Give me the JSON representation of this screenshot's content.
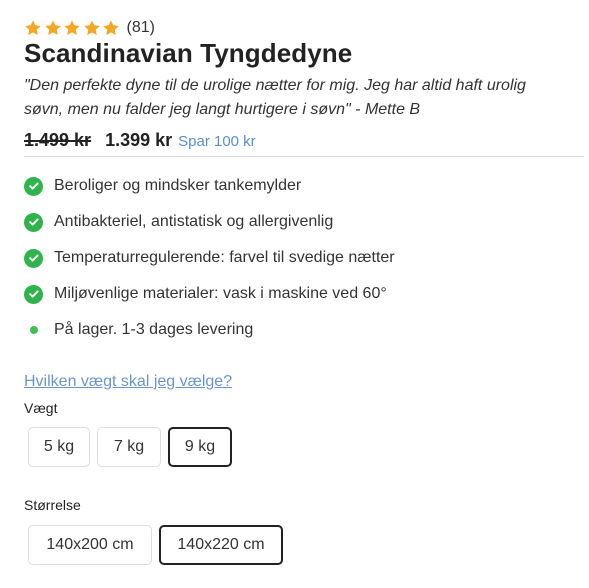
{
  "rating": {
    "stars": 5,
    "review_count": "(81)",
    "star_color": "#f5a623"
  },
  "product": {
    "title": "Scandinavian Tyngdedyne",
    "quote": "\"Den perfekte dyne til de urolige nætter for mig. Jeg har altid haft urolig søvn, men nu falder jeg langt hurtigere i søvn\" - Mette B"
  },
  "price": {
    "old": "1.499 kr",
    "current": "1.399 kr",
    "savings": "Spar 100 kr",
    "savings_color": "#5b8fc7"
  },
  "features": [
    {
      "icon": "check-circle-icon",
      "text": "Beroliger og mindsker tankemylder"
    },
    {
      "icon": "check-circle-icon",
      "text": "Antibakteriel, antistatisk og allergivenlig"
    },
    {
      "icon": "check-circle-icon",
      "text": "Temperaturregulerende: farvel til svedige nætter"
    },
    {
      "icon": "check-circle-icon",
      "text": "Miljøvenlige materialer: vask i maskine ved 60°"
    }
  ],
  "stock": {
    "icon": "in-stock-dot-icon",
    "text": "På lager. 1-3 dages levering",
    "color": "#3fc04f"
  },
  "help_link": "Hvilken vægt skal jeg vælge?",
  "weight": {
    "label": "Vægt",
    "options": [
      "5 kg",
      "7 kg",
      "9 kg"
    ],
    "selected": "9 kg"
  },
  "size": {
    "label": "Størrelse",
    "options": [
      "140x200 cm",
      "140x220 cm"
    ],
    "selected": "140x220 cm"
  },
  "colors": {
    "check": "#2fb34a",
    "link": "#6a96cc",
    "text": "#222222"
  }
}
